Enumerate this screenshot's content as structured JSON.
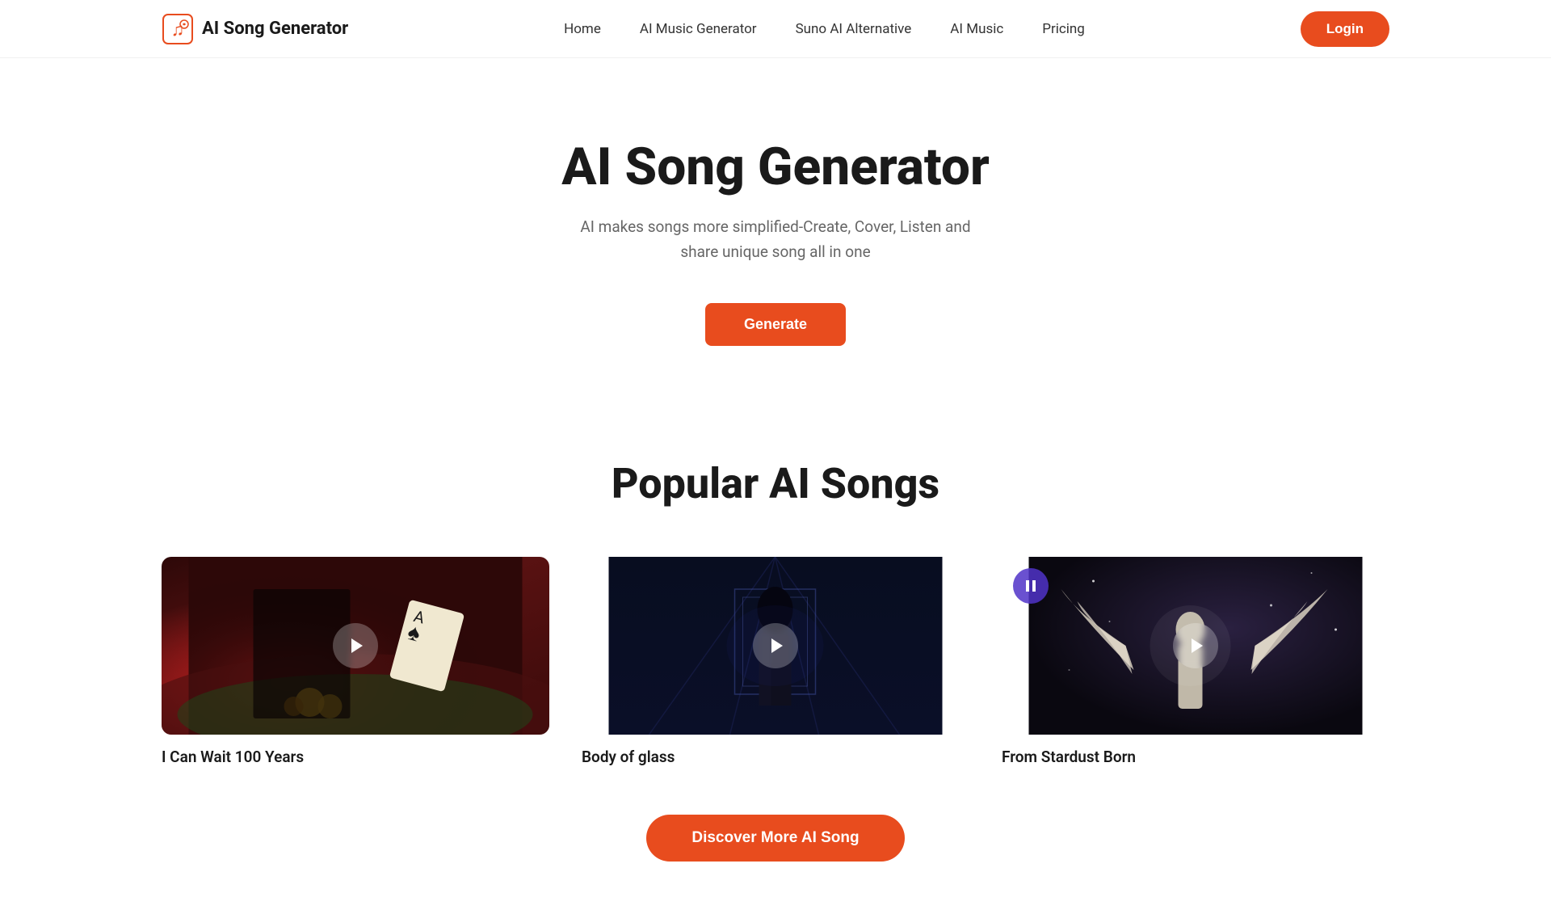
{
  "header": {
    "logo_text": "AI Song Generator",
    "nav_items": [
      {
        "label": "Home",
        "key": "home"
      },
      {
        "label": "AI Music Generator",
        "key": "ai-music-generator"
      },
      {
        "label": "Suno AI Alternative",
        "key": "suno-ai-alternative"
      },
      {
        "label": "AI Music",
        "key": "ai-music"
      },
      {
        "label": "Pricing",
        "key": "pricing"
      }
    ],
    "login_label": "Login"
  },
  "hero": {
    "title": "AI Song Generator",
    "subtitle_line1": "AI makes songs more simplified-Create, Cover, Listen and",
    "subtitle_line2": "share unique song all in one",
    "generate_label": "Generate"
  },
  "popular_section": {
    "title": "Popular AI Songs",
    "songs": [
      {
        "id": "song-1",
        "title": "I Can Wait 100 Years",
        "has_pause_indicator": false,
        "thumb_style": "thumb-1"
      },
      {
        "id": "song-2",
        "title": "Body of glass",
        "has_pause_indicator": false,
        "thumb_style": "thumb-2"
      },
      {
        "id": "song-3",
        "title": "From Stardust Born",
        "has_pause_indicator": true,
        "thumb_style": "thumb-3"
      }
    ],
    "discover_label": "Discover More AI Song"
  },
  "colors": {
    "accent": "#e84c1e",
    "text_primary": "#1a1a1a",
    "text_secondary": "#666666"
  }
}
